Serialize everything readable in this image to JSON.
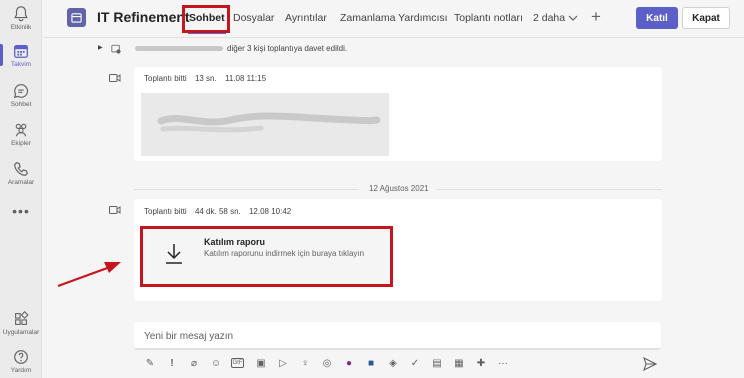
{
  "rail": {
    "items": [
      {
        "label": "Etkinlik"
      },
      {
        "label": "Takvim"
      },
      {
        "label": "Sohbet"
      },
      {
        "label": "Ekipler"
      },
      {
        "label": "Aramalar"
      }
    ],
    "more": "•••",
    "bottom": [
      {
        "label": "Uygulamalar"
      },
      {
        "label": "Yardım"
      }
    ]
  },
  "header": {
    "title": "IT Refinement",
    "tabs": [
      {
        "label": "Sohbet"
      },
      {
        "label": "Dosyalar"
      },
      {
        "label": "Ayrıntılar"
      },
      {
        "label": "Zamanlama Yardımcısı"
      },
      {
        "label": "Toplantı notları"
      },
      {
        "label": "2 daha"
      }
    ],
    "join_label": "Katıl",
    "close_label": "Kapat"
  },
  "feed": {
    "invite_text": "diğer 3 kişi toplantıya davet edildi.",
    "meeting1": {
      "status": "Toplantı bitti",
      "duration": "13 sn.",
      "time": "11.08 11:15"
    },
    "date_divider": "12 Ağustos 2021",
    "meeting2": {
      "status": "Toplantı bitti",
      "duration": "44 dk. 58 sn.",
      "time": "12.08 10:42"
    },
    "report": {
      "title": "Katılım raporu",
      "description": "Katılım raporunu indirmek için buraya tıklayın"
    }
  },
  "compose": {
    "placeholder": "Yeni bir mesaj yazın"
  },
  "colors": {
    "brand": "#5b5fc7",
    "highlight": "#c4161c",
    "arrow": "#c4161c"
  }
}
